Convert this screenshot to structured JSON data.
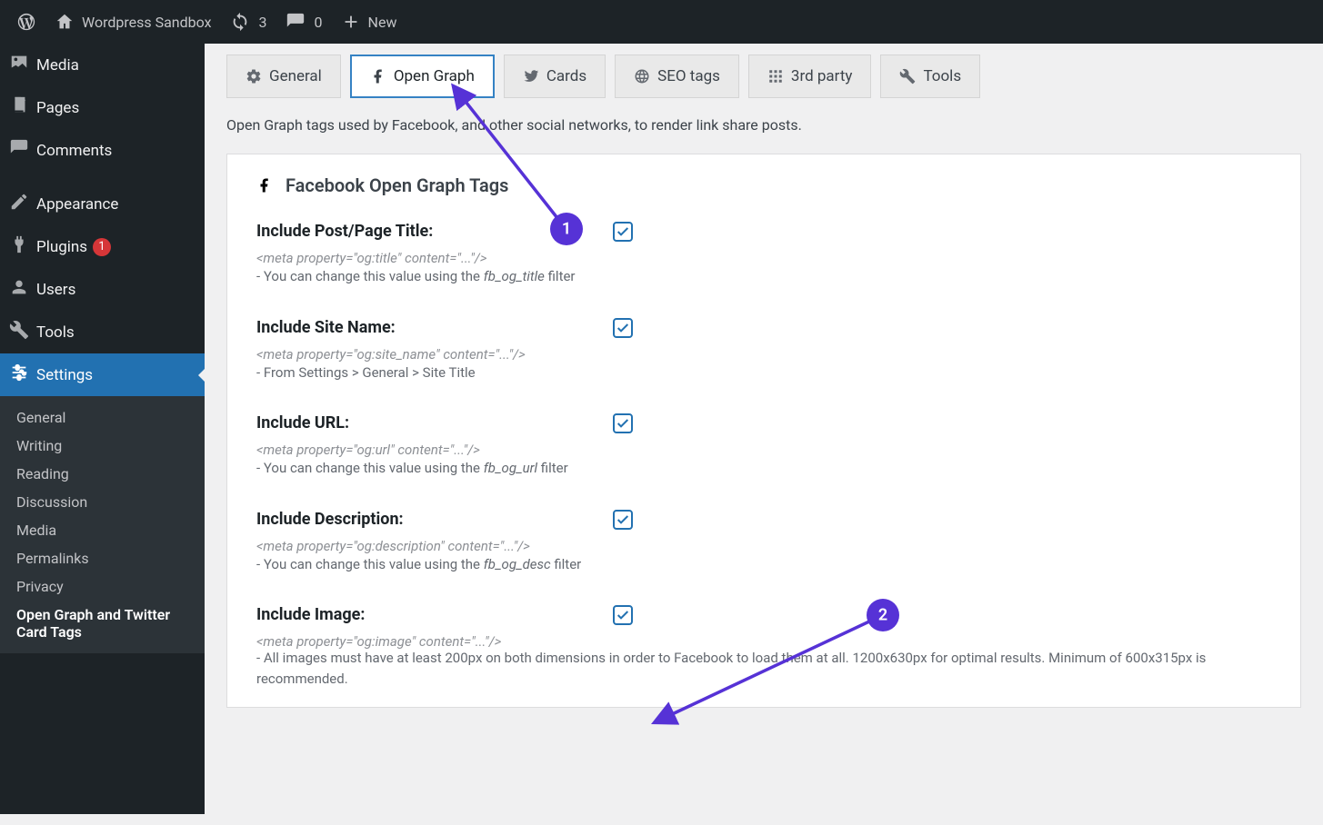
{
  "adminbar": {
    "site_title": "Wordpress Sandbox",
    "updates_count": "3",
    "comments_count": "0",
    "new_label": "New"
  },
  "sidebar": {
    "items": [
      {
        "label": "Media"
      },
      {
        "label": "Pages"
      },
      {
        "label": "Comments"
      },
      {
        "label": "Appearance"
      },
      {
        "label": "Plugins",
        "badge": "1"
      },
      {
        "label": "Users"
      },
      {
        "label": "Tools"
      },
      {
        "label": "Settings",
        "current": true
      }
    ],
    "settings_submenu": [
      "General",
      "Writing",
      "Reading",
      "Discussion",
      "Media",
      "Permalinks",
      "Privacy",
      "Open Graph and Twitter Card Tags"
    ]
  },
  "tabs": {
    "general": "General",
    "open_graph": "Open Graph",
    "cards": "Cards",
    "seo": "SEO tags",
    "third_party": "3rd party",
    "tools": "Tools"
  },
  "page": {
    "description": "Open Graph tags used by Facebook, and other social networks, to render link share posts.",
    "panel_title": "Facebook Open Graph Tags"
  },
  "fields": {
    "title": {
      "label": "Include Post/Page Title:",
      "meta": "<meta property=\"og:title\" content=\"...\"/>",
      "help_pre": "- You can change this value using the ",
      "help_em": "fb_og_title",
      "help_post": " filter",
      "checked": true
    },
    "sitename": {
      "label": "Include Site Name:",
      "meta": "<meta property=\"og:site_name\" content=\"...\"/>",
      "help": "- From Settings > General > Site Title",
      "checked": true
    },
    "url": {
      "label": "Include URL:",
      "meta": "<meta property=\"og:url\" content=\"...\"/>",
      "help_pre": "- You can change this value using the ",
      "help_em": "fb_og_url",
      "help_post": " filter",
      "checked": true
    },
    "desc": {
      "label": "Include Description:",
      "meta": "<meta property=\"og:description\" content=\"...\"/>",
      "help_pre": "- You can change this value using the ",
      "help_em": "fb_og_desc",
      "help_post": " filter",
      "checked": true
    },
    "image": {
      "label": "Include Image:",
      "meta": "<meta property=\"og:image\" content=\"...\"/>",
      "help": "- All images must have at least 200px on both dimensions in order to Facebook to load them at all. 1200x630px for optimal results. Minimum of 600x315px is recommended.",
      "checked": true
    }
  },
  "annotations": {
    "one": "1",
    "two": "2"
  }
}
